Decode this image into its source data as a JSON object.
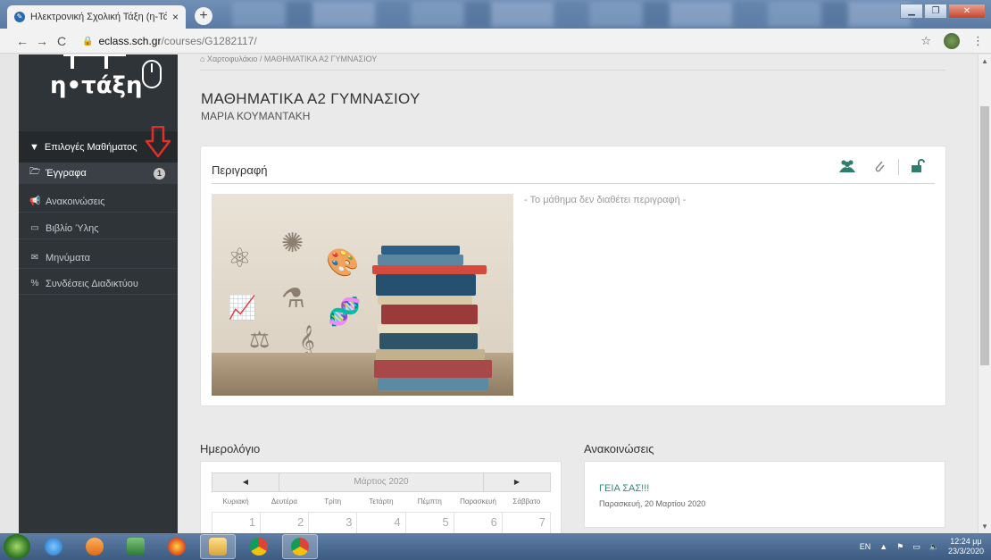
{
  "browser": {
    "tab_title": "Ηλεκτρονική Σχολική Τάξη (η-Τά",
    "tab_close": "×",
    "new_tab": "+",
    "url_host": "eclass.sch.gr",
    "url_path": "/courses/G1282117/",
    "back": "←",
    "forward": "→",
    "reload": "C",
    "star": "☆",
    "menu": "⋮"
  },
  "sidebar": {
    "logo_text": "η•τάξη",
    "section_label": "Επιλογές Μαθήματος",
    "items": [
      {
        "label": "Έγγραφα",
        "icon": "folder-open-icon",
        "badge": "1"
      },
      {
        "label": "Ανακοινώσεις",
        "icon": "megaphone-icon"
      },
      {
        "label": "Βιβλίο Ύλης",
        "icon": "calendar-icon"
      },
      {
        "label": "Μηνύματα",
        "icon": "envelope-icon"
      },
      {
        "label": "Συνδέσεις Διαδικτύου",
        "icon": "link-icon"
      }
    ]
  },
  "main": {
    "breadcrumb": "⌂ Χαρτοφυλάκιο  /  ΜΑΘΗΜΑΤΙΚΑ Α2 ΓΥΜΝΑΣΙΟΥ",
    "course_title": "ΜΑΘΗΜΑΤΙΚΑ Α2 ΓΥΜΝΑΣΙΟΥ",
    "teacher": "ΜΑΡΙΑ ΚΟΥΜΑΝΤΑΚΗ",
    "description_panel": {
      "title": "Περιγραφή",
      "no_description": "- Το μάθημα δεν διαθέτει περιγραφή -"
    },
    "calendar": {
      "title": "Ημερολόγιο",
      "prev": "◀",
      "next": "▶",
      "month": "Μάρτιος 2020",
      "days": [
        "Κυριακή",
        "Δευτέρα",
        "Τρίτη",
        "Τετάρτη",
        "Πέμπτη",
        "Παρασκευή",
        "Σάββατο"
      ],
      "first_week": [
        "1",
        "2",
        "3",
        "4",
        "5",
        "6",
        "7"
      ]
    },
    "announcements": {
      "title": "Ανακοινώσεις",
      "items": [
        {
          "title": "ΓΕΙΑ ΣΑΣ!!!",
          "date": "Παρασκευή, 20 Μαρτίου 2020"
        }
      ]
    }
  },
  "taskbar": {
    "lang": "EN",
    "time": "12:24 μμ",
    "date": "23/3/2020"
  },
  "colors": {
    "sidebar_bg": "#2f3438",
    "accent": "#2e7d6d",
    "link": "#2e8a7a",
    "arrow": "#e0302a"
  }
}
